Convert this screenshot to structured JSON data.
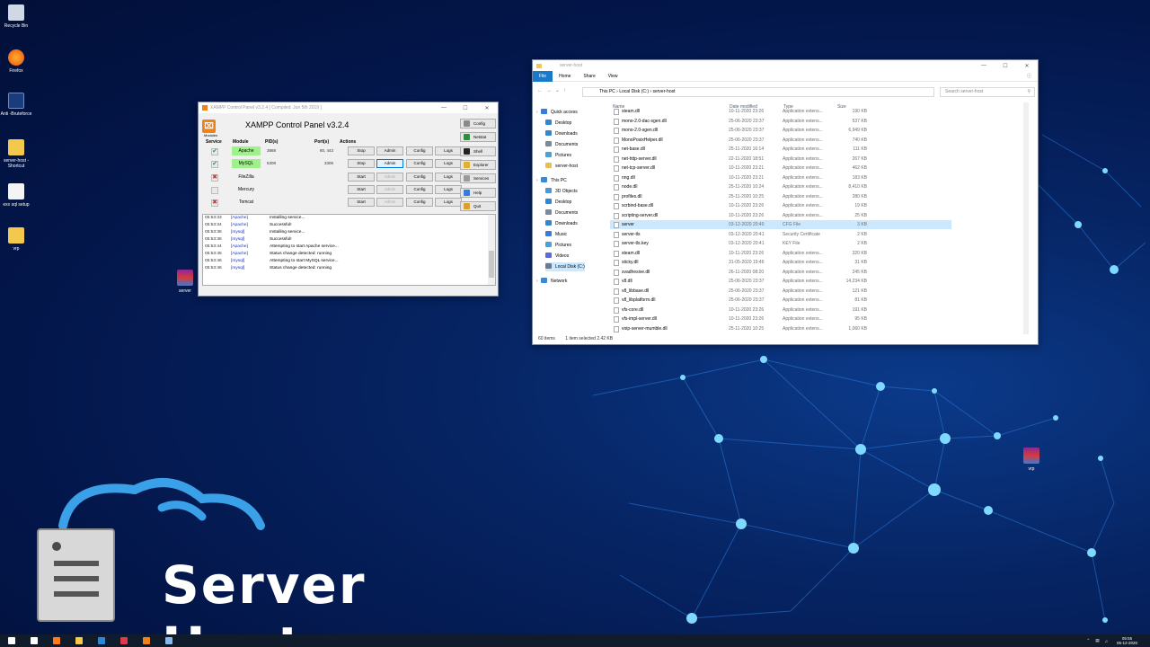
{
  "desktop": {
    "icons": [
      {
        "label": "Recycle Bin",
        "icon": "recycle-bin-icon"
      },
      {
        "label": "Firefox",
        "icon": "firefox-icon"
      },
      {
        "label": "Anti -Bruteforce",
        "icon": "anti-bruteforce-icon"
      },
      {
        "label": "server-host - Shortcut",
        "icon": "folder-shortcut-icon"
      },
      {
        "label": "exx sql setup",
        "icon": "document-icon"
      },
      {
        "label": "vrp",
        "icon": "folder-icon"
      }
    ],
    "floating_icons": [
      {
        "label": "server",
        "icon": "winrar-archive-icon"
      },
      {
        "label": "vrp",
        "icon": "winrar-archive-icon"
      }
    ],
    "brand": {
      "text": "Server Host",
      "logo": "server-cloud-logo"
    }
  },
  "xampp": {
    "window_title": "XAMPP Control Panel v3.2.4   [ Compiled: Jun 5th 2019 ]",
    "heading": "XAMPP Control Panel v3.2.4",
    "modules_label": "Modules",
    "headers": {
      "service": "Service",
      "module": "Module",
      "pid": "PID(s)",
      "port": "Port(s)",
      "actions": "Actions"
    },
    "rows": [
      {
        "service": "✔",
        "module": "Apache",
        "pid": "3888",
        "port": "80, 443",
        "action": "Stop",
        "admin": "Admin",
        "config": "Config",
        "logs": "Logs",
        "running": true
      },
      {
        "service": "✔",
        "module": "MySQL",
        "pid": "5308",
        "port": "3306",
        "action": "Stop",
        "admin": "Admin",
        "config": "Config",
        "logs": "Logs",
        "running": true
      },
      {
        "service": "✖",
        "module": "FileZilla",
        "pid": "",
        "port": "",
        "action": "Start",
        "admin": "Admin",
        "config": "Config",
        "logs": "Logs",
        "running": false
      },
      {
        "service": "",
        "module": "Mercury",
        "pid": "",
        "port": "",
        "action": "Start",
        "admin": "Admin",
        "config": "Config",
        "logs": "Logs",
        "running": false
      },
      {
        "service": "✖",
        "module": "Tomcat",
        "pid": "",
        "port": "",
        "action": "Start",
        "admin": "Admin",
        "config": "Config",
        "logs": "Logs",
        "running": false
      }
    ],
    "side_buttons": [
      {
        "label": "Config",
        "icon": "wrench-icon",
        "color": "#8a8a8a"
      },
      {
        "label": "Netstat",
        "icon": "globe-icon",
        "color": "#2c8f3c"
      },
      {
        "label": "Shell",
        "icon": "terminal-icon",
        "color": "#222222"
      },
      {
        "label": "Explorer",
        "icon": "folder-icon",
        "color": "#e0b030"
      },
      {
        "label": "Services",
        "icon": "services-icon",
        "color": "#9a9a9a"
      },
      {
        "label": "Help",
        "icon": "help-icon",
        "color": "#3a7ad8"
      },
      {
        "label": "Quit",
        "icon": "quit-icon",
        "color": "#d8a030"
      }
    ],
    "log": [
      {
        "time": "05:53:33",
        "source": "[Apache]",
        "message": "Installing service..."
      },
      {
        "time": "05:53:34",
        "source": "[Apache]",
        "message": "Successful!"
      },
      {
        "time": "05:53:36",
        "source": "[mysql]",
        "message": "Installing service..."
      },
      {
        "time": "05:53:36",
        "source": "[mysql]",
        "message": "Successful!"
      },
      {
        "time": "05:53:44",
        "source": "[Apache]",
        "message": "Attempting to start Apache service..."
      },
      {
        "time": "05:53:45",
        "source": "[Apache]",
        "message": "Status change detected: running"
      },
      {
        "time": "05:53:46",
        "source": "[mysql]",
        "message": "Attempting to start MySQL service..."
      },
      {
        "time": "05:53:46",
        "source": "[mysql]",
        "message": "Status change detected: running"
      }
    ]
  },
  "explorer": {
    "window_title": "server-host",
    "ribbon": [
      "File",
      "Home",
      "Share",
      "View"
    ],
    "breadcrumb": [
      "This PC",
      "Local Disk (C:)",
      "server-host"
    ],
    "search_placeholder": "Search server-host",
    "nav": [
      {
        "label": "Quick access",
        "icon": "star-icon",
        "color": "#3a7ad8",
        "indent": 0
      },
      {
        "label": "Desktop",
        "icon": "desktop-icon",
        "color": "#2e88d8",
        "indent": 1
      },
      {
        "label": "Downloads",
        "icon": "download-icon",
        "color": "#2e88d8",
        "indent": 1
      },
      {
        "label": "Documents",
        "icon": "documents-icon",
        "color": "#7a8a9a",
        "indent": 1
      },
      {
        "label": "Pictures",
        "icon": "pictures-icon",
        "color": "#4aa0d8",
        "indent": 1
      },
      {
        "label": "server-host",
        "icon": "folder-icon",
        "color": "#e8c050",
        "indent": 1
      },
      {
        "label": "This PC",
        "icon": "computer-icon",
        "color": "#3a88d8",
        "indent": 0
      },
      {
        "label": "3D Objects",
        "icon": "3d-objects-icon",
        "color": "#4a98d8",
        "indent": 1
      },
      {
        "label": "Desktop",
        "icon": "desktop-icon",
        "color": "#2e88d8",
        "indent": 1
      },
      {
        "label": "Documents",
        "icon": "documents-icon",
        "color": "#7a8a9a",
        "indent": 1
      },
      {
        "label": "Downloads",
        "icon": "download-icon",
        "color": "#2e88d8",
        "indent": 1
      },
      {
        "label": "Music",
        "icon": "music-icon",
        "color": "#3a7ad8",
        "indent": 1
      },
      {
        "label": "Pictures",
        "icon": "pictures-icon",
        "color": "#4aa0d8",
        "indent": 1
      },
      {
        "label": "Videos",
        "icon": "videos-icon",
        "color": "#5a6ad8",
        "indent": 1
      },
      {
        "label": "Local Disk (C:)",
        "icon": "disk-icon",
        "color": "#6a7a8a",
        "indent": 1,
        "selected": true
      },
      {
        "label": "Network",
        "icon": "network-icon",
        "color": "#3a88d8",
        "indent": 0
      }
    ],
    "columns": {
      "name": "Name",
      "date": "Date modified",
      "type": "Type",
      "size": "Size"
    },
    "files": [
      {
        "name": "steam.dll",
        "date": "10-11-2020 23:26",
        "type": "Application extens...",
        "size": "190 KB"
      },
      {
        "name": "mono-2.0-dac-sgen.dll",
        "date": "25-06-2020 23:37",
        "type": "Application extens...",
        "size": "537 KB"
      },
      {
        "name": "mono-2.0-sgen.dll",
        "date": "25-06-2020 23:37",
        "type": "Application extens...",
        "size": "6,949 KB"
      },
      {
        "name": "MonoPosixHelper.dll",
        "date": "25-06-2020 23:37",
        "type": "Application extens...",
        "size": "740 KB"
      },
      {
        "name": "net-base.dll",
        "date": "25-11-2020 16:14",
        "type": "Application extens...",
        "size": "111 KB"
      },
      {
        "name": "net-http-server.dll",
        "date": "22-11-2020 18:51",
        "type": "Application extens...",
        "size": "267 KB"
      },
      {
        "name": "net-tcp-server.dll",
        "date": "10-11-2020 23:21",
        "type": "Application extens...",
        "size": "462 KB"
      },
      {
        "name": "nng.dll",
        "date": "10-11-2020 23:21",
        "type": "Application extens...",
        "size": "183 KB"
      },
      {
        "name": "node.dll",
        "date": "25-11-2020 10:24",
        "type": "Application extens...",
        "size": "8,410 KB"
      },
      {
        "name": "profiles.dll",
        "date": "25-11-2020 10:25",
        "type": "Application extens...",
        "size": "280 KB"
      },
      {
        "name": "scrbind-base.dll",
        "date": "10-11-2020 23:26",
        "type": "Application extens...",
        "size": "19 KB"
      },
      {
        "name": "scripting-server.dll",
        "date": "10-11-2020 23:26",
        "type": "Application extens...",
        "size": "25 KB"
      },
      {
        "name": "server",
        "date": "03-12-2020 20:40",
        "type": "CFG File",
        "size": "3 KB",
        "selected": true
      },
      {
        "name": "server-tls",
        "date": "03-12-2020 20:41",
        "type": "Security Certificate",
        "size": "2 KB"
      },
      {
        "name": "server-tls.key",
        "date": "03-12-2020 20:41",
        "type": "KEY File",
        "size": "2 KB"
      },
      {
        "name": "steam.dll",
        "date": "10-11-2020 23:26",
        "type": "Application extens...",
        "size": "320 KB"
      },
      {
        "name": "sticky.dll",
        "date": "31-05-2020 19:46",
        "type": "Application extens...",
        "size": "31 KB"
      },
      {
        "name": "svadhesive.dll",
        "date": "26-11-2020 08:20",
        "type": "Application extens...",
        "size": "245 KB"
      },
      {
        "name": "v8.dll",
        "date": "25-06-2020 23:37",
        "type": "Application extens...",
        "size": "14,234 KB"
      },
      {
        "name": "v8_libbase.dll",
        "date": "25-06-2020 23:37",
        "type": "Application extens...",
        "size": "121 KB"
      },
      {
        "name": "v8_libplatform.dll",
        "date": "25-06-2020 23:37",
        "type": "Application extens...",
        "size": "81 KB"
      },
      {
        "name": "vfs-core.dll",
        "date": "10-11-2020 23:26",
        "type": "Application extens...",
        "size": "191 KB"
      },
      {
        "name": "vfs-impl-server.dll",
        "date": "10-11-2020 23:26",
        "type": "Application extens...",
        "size": "95 KB"
      },
      {
        "name": "voip-server-mumble.dll",
        "date": "25-11-2020 10:25",
        "type": "Application extens...",
        "size": "1,060 KB"
      }
    ],
    "status": {
      "count": "60 items",
      "selection": "1 item selected  2.42 KB"
    }
  },
  "taskbar": {
    "icons": [
      {
        "name": "windows-start-icon",
        "color": "#ffffff"
      },
      {
        "name": "search-icon",
        "color": "#ffffff"
      },
      {
        "name": "firefox-icon",
        "color": "#ff7a1a"
      },
      {
        "name": "file-explorer-icon",
        "color": "#f2c94c"
      },
      {
        "name": "mail-icon",
        "color": "#2b88d8"
      },
      {
        "name": "app-red-icon",
        "color": "#e03a4a"
      },
      {
        "name": "xampp-icon",
        "color": "#f08218"
      },
      {
        "name": "notepad-icon",
        "color": "#8ab8e8"
      }
    ],
    "time": "05:55",
    "date": "05-12-2020"
  }
}
